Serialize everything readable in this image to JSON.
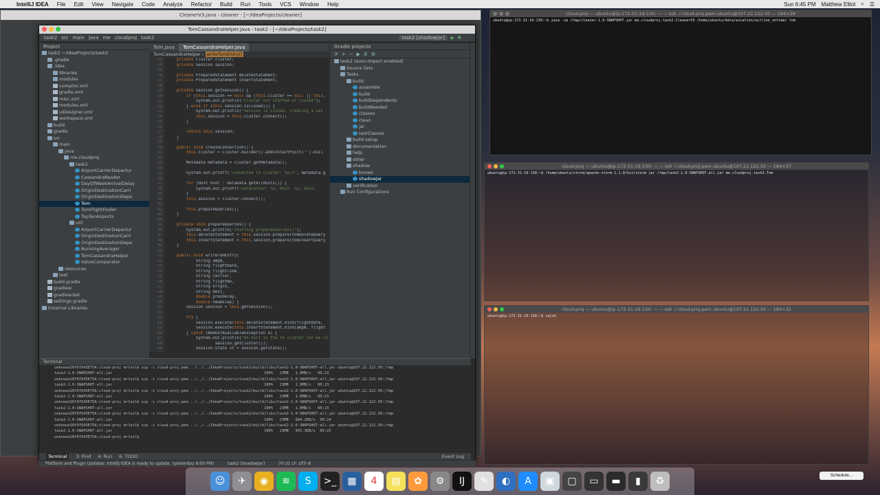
{
  "menubar": {
    "app_name": "IntelliJ IDEA",
    "items": [
      "File",
      "Edit",
      "View",
      "Navigate",
      "Code",
      "Analyze",
      "Refactor",
      "Build",
      "Run",
      "Tools",
      "VCS",
      "Window",
      "Help"
    ],
    "clock": "Sun 6:45 PM",
    "user": "Matthew Elliot"
  },
  "back_window": {
    "title": "CleanerV3.java - cleaner - [~/IdeaProjects/cleaner]"
  },
  "ide": {
    "title": "TomCassandraHelper.java - task2 - [~/IdeaProjects/task2]",
    "nav_crumbs": [
      "task2",
      "src",
      "main",
      "java",
      "me",
      "cloudproj",
      "task2"
    ],
    "run_config": "task2 [shadowJar]",
    "project_header": "Project",
    "project_tree": [
      {
        "label": "task2 ~/IdeaProjects/task2",
        "indent": 0,
        "type": "folder"
      },
      {
        "label": ".gradle",
        "indent": 1,
        "type": "folder"
      },
      {
        "label": ".idea",
        "indent": 1,
        "type": "folder"
      },
      {
        "label": "libraries",
        "indent": 2,
        "type": "folder"
      },
      {
        "label": "modules",
        "indent": 2,
        "type": "folder"
      },
      {
        "label": "compiler.xml",
        "indent": 2,
        "type": "file"
      },
      {
        "label": "gradle.xml",
        "indent": 2,
        "type": "file"
      },
      {
        "label": "misc.xml",
        "indent": 2,
        "type": "file"
      },
      {
        "label": "modules.xml",
        "indent": 2,
        "type": "file"
      },
      {
        "label": "uiDesigner.xml",
        "indent": 2,
        "type": "file"
      },
      {
        "label": "workspace.xml",
        "indent": 2,
        "type": "file"
      },
      {
        "label": "build",
        "indent": 1,
        "type": "folder"
      },
      {
        "label": "gradle",
        "indent": 1,
        "type": "folder"
      },
      {
        "label": "src",
        "indent": 1,
        "type": "folder"
      },
      {
        "label": "main",
        "indent": 2,
        "type": "folder"
      },
      {
        "label": "java",
        "indent": 3,
        "type": "folder"
      },
      {
        "label": "me.cloudproj",
        "indent": 4,
        "type": "folder"
      },
      {
        "label": "task2",
        "indent": 5,
        "type": "folder"
      },
      {
        "label": "AirportCarrierDepartur",
        "indent": 6,
        "type": "cls"
      },
      {
        "label": "CassandraReader",
        "indent": 6,
        "type": "cls"
      },
      {
        "label": "DayOfWeekArrivalDelay",
        "indent": 6,
        "type": "cls"
      },
      {
        "label": "OriginDestinationCarri",
        "indent": 6,
        "type": "cls"
      },
      {
        "label": "OriginDestinationDepa",
        "indent": 6,
        "type": "cls"
      },
      {
        "label": "Tom",
        "indent": 6,
        "type": "cls",
        "selected": true
      },
      {
        "label": "TomFlightFinder",
        "indent": 6,
        "type": "cls"
      },
      {
        "label": "TopTenAirports",
        "indent": 6,
        "type": "cls"
      },
      {
        "label": "util",
        "indent": 5,
        "type": "folder"
      },
      {
        "label": "AirportCarrierDepartur",
        "indent": 6,
        "type": "cls"
      },
      {
        "label": "OriginDestinationCarri",
        "indent": 6,
        "type": "cls"
      },
      {
        "label": "OriginDestinationDepa",
        "indent": 6,
        "type": "cls"
      },
      {
        "label": "RunningAverager",
        "indent": 6,
        "type": "cls"
      },
      {
        "label": "TomCassandraHelper",
        "indent": 6,
        "type": "cls"
      },
      {
        "label": "ValueComparator",
        "indent": 6,
        "type": "cls"
      },
      {
        "label": "resources",
        "indent": 3,
        "type": "folder"
      },
      {
        "label": "test",
        "indent": 2,
        "type": "folder"
      },
      {
        "label": "build.gradle",
        "indent": 1,
        "type": "file"
      },
      {
        "label": "gradlew",
        "indent": 1,
        "type": "file"
      },
      {
        "label": "gradlew.bat",
        "indent": 1,
        "type": "file"
      },
      {
        "label": "settings.gradle",
        "indent": 1,
        "type": "file"
      },
      {
        "label": "External Libraries",
        "indent": 0,
        "type": "folder"
      }
    ],
    "editor_tabs": [
      "Tom.java",
      "TomCassandraHelper.java"
    ],
    "editor_crumbs": [
      "TomCassandraHelper",
      "writeTomEntry()"
    ],
    "line_numbers": [
      "13",
      "14",
      "15",
      "16",
      "17",
      "18",
      "19",
      "20",
      "21",
      "22",
      "23",
      "24",
      "25",
      "26",
      "27",
      "28",
      "29",
      "30",
      "31",
      "32",
      "33",
      "34",
      "35",
      "36",
      "37",
      "38",
      "39",
      "40",
      "41",
      "42",
      "43",
      "44",
      "45",
      "46",
      "47",
      "48",
      "49",
      "50",
      "51",
      "52",
      "53",
      "54",
      "55",
      "56",
      "57",
      "58",
      "59",
      "60",
      "61",
      "62",
      "63",
      "64",
      "65",
      "66",
      "67",
      "68",
      "69",
      "70",
      "71",
      "72"
    ],
    "code_lines": [
      "    private Cluster cluster;",
      "    private Session session;",
      "",
      "    private PreparedStatement deleteStatement;",
      "    private PreparedStatement insertStatement;",
      "",
      "    private Session getSession() {",
      "        if (this.session == null && (this.cluster == null || this.",
      "            System.out.println(\"Cluster not started or closed\");",
      "        } else if (this.session.isClosed()) {",
      "            System.out.println(\"Session is closed. Creating a ses",
      "            this.session = this.cluster.connect();",
      "        }",
      "",
      "        return this.session;",
      "    }",
      "",
      "    public void createConnection() {",
      "        this.cluster = Cluster.builder().addContactPoint(\"\").buil",
      "",
      "        Metadata metadata = cluster.getMetadata();",
      "",
      "        System.out.printf(\"Connected to cluster: %s\\n\", metadata.g",
      "",
      "        for (Host host : metadata.getAllHosts()) {",
      "            System.out.printf(\"Datacenter: %s; Host: %s; Rack: ",
      "        }",
      "        this.session = cluster.connect();",
      "",
      "        this.prepareQueries();",
      "    }",
      "",
      "    private void prepareQueries() {",
      "        System.out.println(\"Starting prepareQueries()\");",
      "        this.deleteStatement = this.session.prepare(tomDeleteQuery",
      "        this.insertStatement = this.session.prepare(tomInsertQuery",
      "    }",
      "",
      "    public void writeTomEntry(",
      "            String ampm,",
      "            String flightDate,",
      "            String flightTime,",
      "            String carrier,",
      "            String flightNo,",
      "            String origin,",
      "            String dest,",
      "            double prevDelay,",
      "            double newDelay) {",
      "        Session session = this.getSession();",
      "",
      "        try {",
      "            session.execute(this.deleteStatement.bind(flightDate,",
      "            session.execute(this.insertStatement.bind(ampm, flight",
      "        } catch (NoHostAvailableException e) {",
      "            System.out.println(\"No host in the %s cluster can be co",
      "                    session.getCluster());",
      "            Session.State st = session.getState();"
    ],
    "gradle_header": "Gradle projects",
    "gradle_tree": [
      {
        "label": "task2 (auto-import enabled)",
        "indent": 0
      },
      {
        "label": "Source Sets",
        "indent": 1
      },
      {
        "label": "Tasks",
        "indent": 1
      },
      {
        "label": "build",
        "indent": 2
      },
      {
        "label": "assemble",
        "indent": 3
      },
      {
        "label": "build",
        "indent": 3
      },
      {
        "label": "buildDependents",
        "indent": 3
      },
      {
        "label": "buildNeeded",
        "indent": 3
      },
      {
        "label": "classes",
        "indent": 3
      },
      {
        "label": "clean",
        "indent": 3
      },
      {
        "label": "jar",
        "indent": 3
      },
      {
        "label": "testClasses",
        "indent": 3
      },
      {
        "label": "build setup",
        "indent": 2
      },
      {
        "label": "documentation",
        "indent": 2
      },
      {
        "label": "help",
        "indent": 2
      },
      {
        "label": "other",
        "indent": 2
      },
      {
        "label": "shadow",
        "indent": 2
      },
      {
        "label": "knows",
        "indent": 3
      },
      {
        "label": "shadowJar",
        "indent": 3,
        "selected": true
      },
      {
        "label": "verification",
        "indent": 2
      },
      {
        "label": "Run Configurations",
        "indent": 1
      }
    ],
    "terminal_header": "Terminal",
    "terminal_lines": [
      "unknown20f07643E75A:cloud-proj mrleit$ scp -i cloud-proj.pem ../../../IdeaProjects/task2/build/libs/task2-1.0-SNAPSHOT-all.jar ubuntu@107.22.122.50:/tmp",
      "task2-1.0-SNAPSHOT-all.jar                                                                    100%   23MB   1.0MB/s   00:23",
      "unknown20f07643E75A:cloud-proj mrleit$ scp -i cloud-proj.pem ../../../IdeaProjects/task2/build/libs/task2-1.0-SNAPSHOT-all.jar ubuntu@107.22.122.50:/tmp",
      "task2-1.0-SNAPSHOT-all.jar                                                                    100%   23MB   1.0MB/s   00:23",
      "unknown20f07643E75A:cloud-proj mrleit$ scp -i cloud-proj.pem ../../../IdeaProjects/task2/build/libs/task2-1.0-SNAPSHOT-all.jar ubuntu@107.22.122.50:/tmp",
      "task2-1.0-SNAPSHOT-all.jar                                                                    100%   23MB   1.0MB/s   00:23",
      "unknown20f07643E75A:cloud-proj mrleit$ scp -i cloud-proj.pem ../../../IdeaProjects/task2/build/libs/task2-1.0-SNAPSHOT-all.jar ubuntu@107.22.122.50:/tmp",
      "task2-1.0-SNAPSHOT-all.jar                                                                    100%   23MB   1.0MB/s   00:23",
      "unknown20f07643E75A:cloud-proj mrleit$ scp -i cloud-proj.pem ../../../IdeaProjects/task2/build/libs/task2-1.0-SNAPSHOT-all.jar ubuntu@107.22.122.50:/tmp",
      "task2-1.0-SNAPSHOT-all.jar                                                                    100%   23MB   994.2KB/s  00:24",
      "unknown20f07643E75A:cloud-proj mrleit$ scp -i cloud-proj.pem ../../../IdeaProjects/task2/build/libs/task2-1.0-SNAPSHOT-all.jar ubuntu@107.22.122.50:/tmp",
      "task2-1.0-SNAPSHOT-all.jar                                                                    100%   23MB   955.3KB/s  00:25",
      "unknown20f07643E75A:cloud-proj mrleit$ "
    ],
    "bottom_tools": [
      "Terminal",
      "3: Find",
      "4: Run",
      "6: TODO"
    ],
    "event_log": "Event Log",
    "status": "Platform and Plugin Updates: IntelliJ IDEA is ready to update. (yesterday 8:00 PM)",
    "status_run": "task2 [shadowJar]",
    "caret": "70:31  LF:  UTF-8"
  },
  "term1": {
    "title": "cloud-proj — ubuntu@ip-172-31-19-130: ~ — ssh -i cloud-proj.pem ubuntu@107.22.122.50 — 184×28",
    "line": "ubuntu@ip-172-31-19-130:~$ java -cp /tmp/cleaner-1.0-SNAPSHOT.jar me.cloudproj.task2.CleanerV3 /home/ubuntu/data/aviation/airline_ontime/ tom"
  },
  "term2": {
    "title": "cloud-proj — ubuntu@ip-172-31-19-130: ~ — ssh -i cloud-proj.pem ubuntu@107.22.122.50 — 184×37",
    "line": "ubuntu@ip-172-31-19-130:~$ /home/ubuntu/storm/apache-storm-1.1.0/bin/storm jar /tmp/task2-1.0-SNAPSHOT-all.jar me.cloudproj.task2.Tom"
  },
  "term3": {
    "title": "cloud-proj — ubuntu@ip-172-31-19-130: ~ — ssh -i cloud-proj.pem ubuntu@107.22.122.50 — 184×32",
    "line": "ubuntu@ip-172-31-19-130:~$ cqlsh"
  },
  "dock": {
    "icons": [
      "finder-icon",
      "launchpad-icon",
      "chrome-icon",
      "spotify-icon",
      "skype-icon",
      "terminal-icon",
      "virtualbox-icon",
      "calendar-icon",
      "notes-icon",
      "photos-icon",
      "system-preferences-icon",
      "intellij-icon",
      "textedit-icon",
      "quicktime-icon",
      "app-store-icon",
      "preview-icon",
      "screenshot-icon",
      "window-icon",
      "window-icon-2",
      "window-icon-3",
      "trash-icon"
    ],
    "calendar_day": "4",
    "schedule_label": "Schedule..."
  },
  "colors": {
    "ide_bg": "#2b2b2b",
    "panel_bg": "#3c3f41",
    "selection": "#0d293e",
    "keyword": "#cc7832",
    "field": "#9876aa",
    "string": "#6a8759"
  }
}
